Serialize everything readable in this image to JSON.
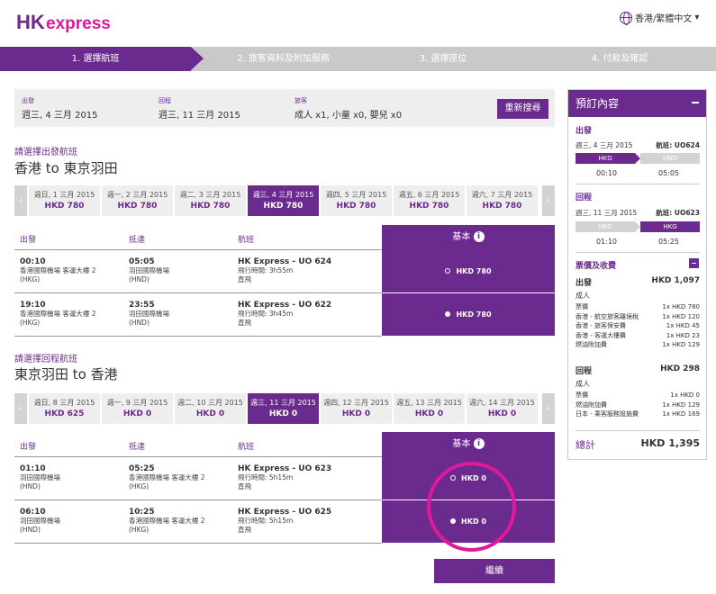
{
  "header": {
    "logo_text": "HKexpress",
    "language": "香港/繁體中文"
  },
  "steps": [
    {
      "label": "1. 選擇航班"
    },
    {
      "label": "2. 旅客資料及附加服務"
    },
    {
      "label": "3. 選擇座位"
    },
    {
      "label": "4. 付款及確認"
    }
  ],
  "search": {
    "depart_label": "出發",
    "depart_value": "週三, 4 三月 2015",
    "return_label": "回程",
    "return_value": "週三, 11 三月 2015",
    "pax_label": "旅客",
    "pax_value": "成人 x1, 小童 x0, 嬰兒 x0",
    "research_button": "重新搜尋"
  },
  "outbound": {
    "title": "請選擇出發航班",
    "route": "香港 to 東京羽田",
    "dates": [
      {
        "d": "週日, 1 三月 2015",
        "p": "HKD 780"
      },
      {
        "d": "週一, 2 三月 2015",
        "p": "HKD 780"
      },
      {
        "d": "週二, 3 三月 2015",
        "p": "HKD 780"
      },
      {
        "d": "週三, 4 三月 2015",
        "p": "HKD 780"
      },
      {
        "d": "週四, 5 三月 2015",
        "p": "HKD 780"
      },
      {
        "d": "週五, 6 三月 2015",
        "p": "HKD 780"
      },
      {
        "d": "週六, 7 三月 2015",
        "p": "HKD 780"
      }
    ],
    "head": {
      "dep": "出發",
      "arr": "抵達",
      "flight": "航班",
      "basic": "基本"
    },
    "rows": [
      {
        "dep_time": "00:10",
        "dep_place": "香港國際機場 客運大樓 2",
        "dep_code": "(HKG)",
        "arr_time": "05:05",
        "arr_place": "羽田國際機場",
        "arr_code": "(HND)",
        "flight": "HK Express - UO 624",
        "duration": "飛行時間: 3h55m",
        "stops": "直飛",
        "fare": "HKD 780"
      },
      {
        "dep_time": "19:10",
        "dep_place": "香港國際機場 客運大樓 2",
        "dep_code": "(HKG)",
        "arr_time": "23:55",
        "arr_place": "羽田國際機場",
        "arr_code": "(HND)",
        "flight": "HK Express - UO 622",
        "duration": "飛行時間: 3h45m",
        "stops": "直飛",
        "fare": "HKD 780"
      }
    ]
  },
  "inbound": {
    "title": "請選擇回程航班",
    "route": "東京羽田 to 香港",
    "dates": [
      {
        "d": "週日, 8 三月 2015",
        "p": "HKD 625"
      },
      {
        "d": "週一, 9 三月 2015",
        "p": "HKD 0"
      },
      {
        "d": "週二, 10 三月 2015",
        "p": "HKD 0"
      },
      {
        "d": "週三, 11 三月 2015",
        "p": "HKD 0"
      },
      {
        "d": "週四, 12 三月 2015",
        "p": "HKD 0"
      },
      {
        "d": "週五, 13 三月 2015",
        "p": "HKD 0"
      },
      {
        "d": "週六, 14 三月 2015",
        "p": "HKD 0"
      }
    ],
    "head": {
      "dep": "出發",
      "arr": "抵達",
      "flight": "航班",
      "basic": "基本"
    },
    "rows": [
      {
        "dep_time": "01:10",
        "dep_place": "羽田國際機場",
        "dep_code": "(HND)",
        "arr_time": "05:25",
        "arr_place": "香港國際機場 客運大樓 2",
        "arr_code": "(HKG)",
        "flight": "HK Express - UO 623",
        "duration": "飛行時間: 5h15m",
        "stops": "直飛",
        "fare": "HKD 0"
      },
      {
        "dep_time": "06:10",
        "dep_place": "羽田國際機場",
        "dep_code": "(HND)",
        "arr_time": "10:25",
        "arr_place": "香港國際機場 客運大樓 2",
        "arr_code": "(HKG)",
        "flight": "HK Express - UO 625",
        "duration": "飛行時間: 5h15m",
        "stops": "直飛",
        "fare": "HKD 0"
      }
    ]
  },
  "continue_button": "繼續",
  "summary": {
    "title": "預訂內容",
    "out_title": "出發",
    "out_date": "週三, 4 三月 2015",
    "out_flight_label": "航班:",
    "out_flight": "UO624",
    "out_from": "HKG",
    "out_to": "HND",
    "out_dep": "00:10",
    "out_arr": "05:05",
    "ret_title": "回程",
    "ret_date": "週三, 11 三月 2015",
    "ret_flight_label": "航班:",
    "ret_flight": "UO623",
    "ret_from": "HND",
    "ret_to": "HKG",
    "ret_dep": "01:10",
    "ret_arr": "05:25",
    "fees_title": "票價及收費",
    "out_sub": "出發",
    "out_sub_total": "HKD 1,097",
    "out_pax": "成人",
    "out_fees": [
      {
        "k": "票價",
        "v": "1x HKD 780"
      },
      {
        "k": "香港 - 航空旅客離境稅",
        "v": "1x HKD 120"
      },
      {
        "k": "香港 - 旅客保安費",
        "v": "1x HKD 45"
      },
      {
        "k": "香港 - 客運大樓費",
        "v": "1x HKD 23"
      },
      {
        "k": "燃油附加費",
        "v": "1x HKD 129"
      }
    ],
    "ret_sub": "回程",
    "ret_sub_total": "HKD 298",
    "ret_pax": "成人",
    "ret_fees": [
      {
        "k": "票價",
        "v": "1x HKD 0"
      },
      {
        "k": "燃油附加費",
        "v": "1x HKD 129"
      },
      {
        "k": "日本 - 乘客服務設施費",
        "v": "1x HKD 169"
      }
    ],
    "total_label": "總計",
    "total_value": "HKD 1,395"
  },
  "colors": {
    "brand": "#6b2a8e",
    "highlight": "#e0189a"
  }
}
